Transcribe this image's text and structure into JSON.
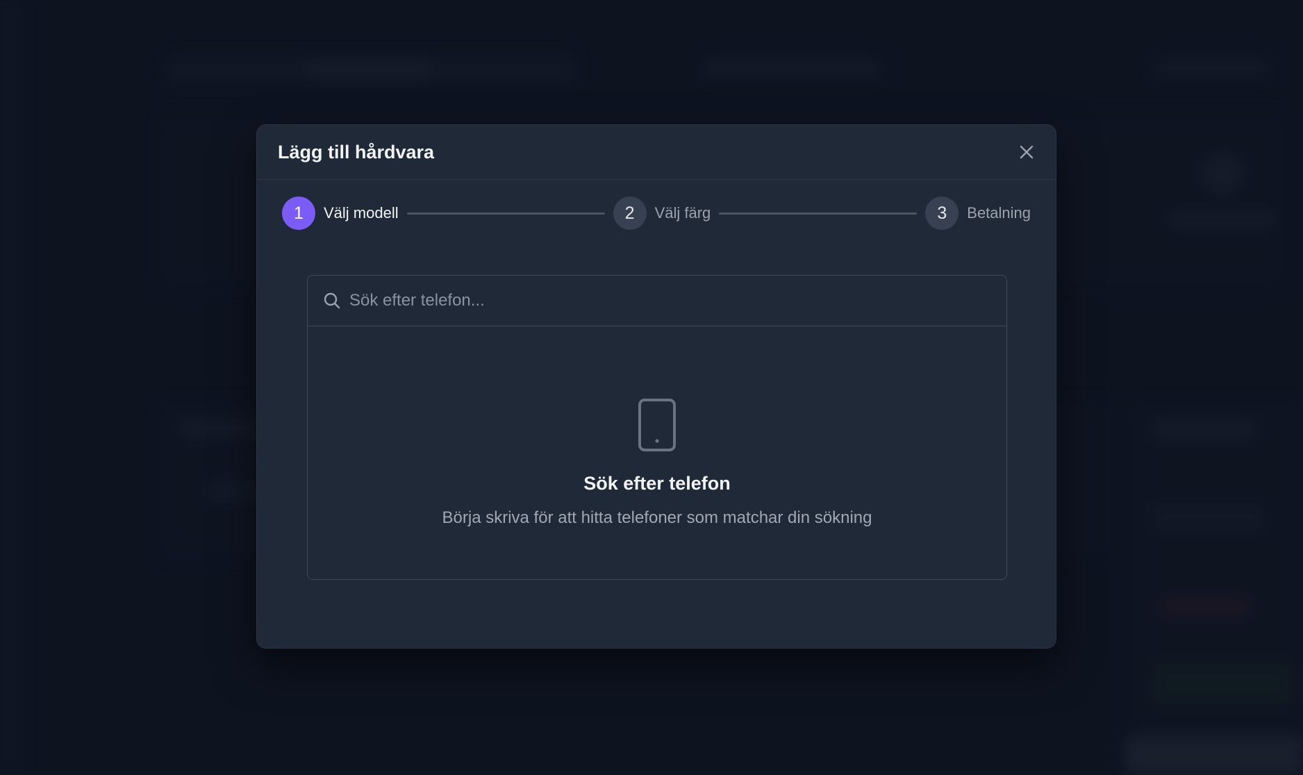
{
  "modal": {
    "title": "Lägg till hårdvara",
    "close_icon": "close-icon"
  },
  "stepper": {
    "steps": [
      {
        "number": "1",
        "label": "Välj modell",
        "state": "active"
      },
      {
        "number": "2",
        "label": "Välj färg",
        "state": "inactive"
      },
      {
        "number": "3",
        "label": "Betalning",
        "state": "inactive"
      }
    ]
  },
  "search": {
    "placeholder": "Sök efter telefon...",
    "value": "",
    "icon": "search-icon"
  },
  "empty_state": {
    "icon": "phone-icon",
    "title": "Sök efter telefon",
    "description": "Börja skriva för att hitta telefoner som matchar din sökning"
  },
  "colors": {
    "accent": "#7c5cf6",
    "modal_bg": "#1f2937",
    "page_bg": "#111827"
  }
}
